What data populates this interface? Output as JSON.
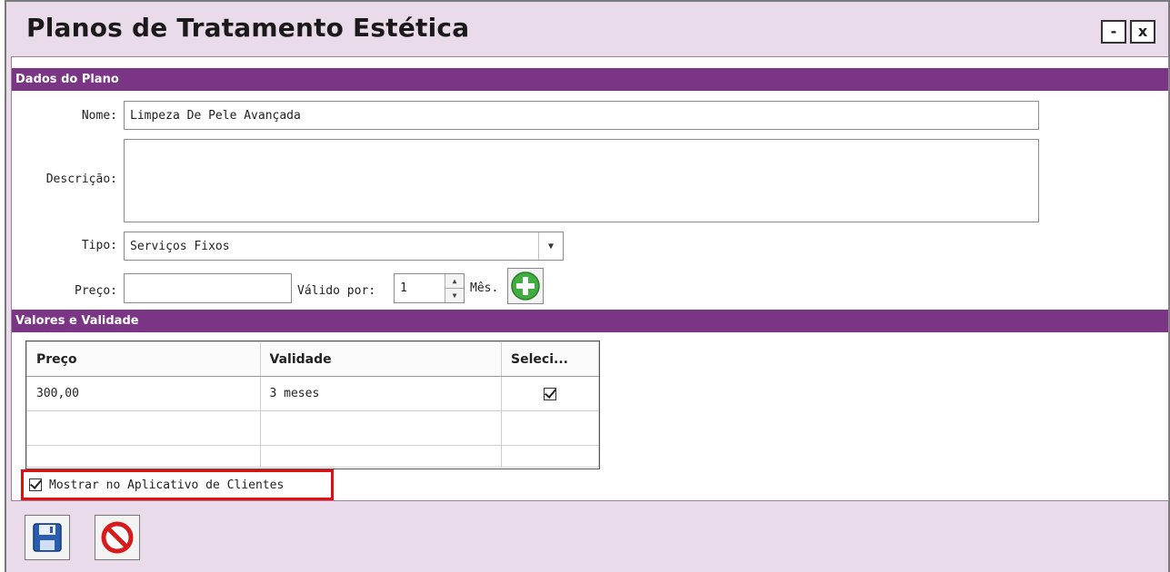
{
  "window": {
    "title": "Planos de Tratamento Estética",
    "minimize_glyph": "-",
    "close_glyph": "x"
  },
  "sections": {
    "dados": "Dados do Plano",
    "valores": "Valores e Validade"
  },
  "form": {
    "nome_label": "Nome:",
    "nome_value": "Limpeza De Pele Avançada",
    "descricao_label": "Descrição:",
    "descricao_value": "",
    "tipo_label": "Tipo:",
    "tipo_value": "Serviços Fixos",
    "preco_label": "Preço:",
    "preco_value": "",
    "valido_label": "Válido por:",
    "valido_value": "1",
    "mes_label": "Mês."
  },
  "grid": {
    "headers": [
      "Preço",
      "Validade",
      "Seleci..."
    ],
    "rows": [
      {
        "preco": "300,00",
        "validade": "3 meses",
        "selecionado": true
      },
      {
        "preco": "",
        "validade": "",
        "selecionado": false
      },
      {
        "preco": "",
        "validade": "",
        "selecionado": false
      }
    ]
  },
  "checkbox": {
    "label": "Mostrar no Aplicativo de Clientes",
    "checked": true
  },
  "icons": {
    "add": "plus-circle-icon",
    "save": "floppy-disk-icon",
    "cancel": "cancel-circle-icon"
  },
  "colors": {
    "section_header": "#7b3585",
    "window_bg": "#eadbea",
    "highlight": "#e01010"
  }
}
